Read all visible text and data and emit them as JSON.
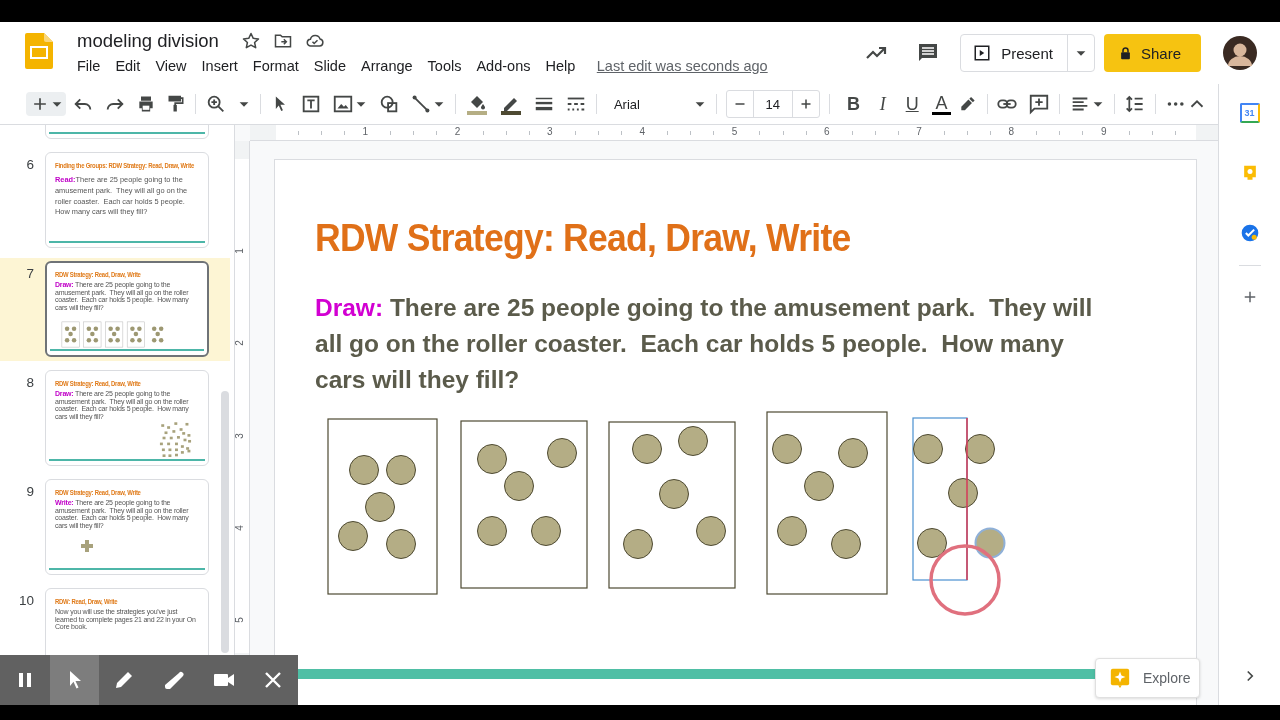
{
  "header": {
    "title": "modeling division",
    "menu": [
      "File",
      "Edit",
      "View",
      "Insert",
      "Format",
      "Slide",
      "Arrange",
      "Tools",
      "Add-ons",
      "Help"
    ],
    "last_edit": "Last edit was seconds ago",
    "present_label": "Present",
    "share_label": "Share"
  },
  "toolbar": {
    "font": "Arial",
    "font_size": "14",
    "format_buttons": [
      "B",
      "I",
      "U",
      "A"
    ]
  },
  "ruler": {
    "horizontal": [
      "1",
      "2",
      "3",
      "4",
      "5",
      "6",
      "7",
      "8",
      "9"
    ],
    "vertical": [
      "1",
      "2",
      "3",
      "4",
      "5"
    ]
  },
  "filmstrip": {
    "slides": [
      {
        "kind": "cut_off",
        "selected": false
      },
      {
        "number": "6",
        "kind": "big_text",
        "selected": false,
        "title": "Finding the Groups: RDW Strategy: Read, Draw, Write",
        "text": "**Read:**There are 25 people going to the amusement park.  They will all go on the roller coaster.  Each car holds 5 people.  How many cars will they fill?"
      },
      {
        "number": "7",
        "kind": "dot_boxes",
        "selected": true,
        "title": "RDW Strategy: Read, Draw, Write",
        "text": "**Draw:** There are 25 people going to the amusement park.  They will all go on the roller coaster.  Each car holds 5 people.  How many cars will they fill?"
      },
      {
        "number": "8",
        "kind": "dot_scatter",
        "selected": false,
        "title": "RDW Strategy: Read, Draw, Write",
        "text": "**Draw:** There are 25 people going to the amusement park.  They will all go on the roller coaster.  Each car holds 5 people.  How many cars will they fill?"
      },
      {
        "number": "9",
        "kind": "plus_mark",
        "selected": false,
        "title": "RDW Strategy: Read, Draw, Write",
        "text": "**Write:** There are 25 people going to the amusement park.  They will all go on the roller coaster.  Each car holds 5 people.  How many cars will they fill?"
      },
      {
        "number": "10",
        "kind": "text_only",
        "selected": false,
        "title": "RDW: Read, Draw, Write",
        "text": "Now you will use the strategies you've just learned to complete pages 21 and 22 in your On Core book."
      }
    ]
  },
  "slide": {
    "title": "RDW Strategy: Read, Draw, Write",
    "text": "**Draw:** There are 25 people going to the amusement park.  They will all go on the roller coaster.  Each car holds 5 people.  How many cars will they fill?"
  },
  "explore": {
    "label": "Explore"
  },
  "side_panel": {
    "calendar_day": "31"
  },
  "recorder": {
    "tools": [
      {
        "selected": false
      },
      {
        "selected": true
      },
      {
        "selected": false
      },
      {
        "selected": false
      },
      {
        "selected": false
      },
      {
        "selected": false
      }
    ]
  }
}
